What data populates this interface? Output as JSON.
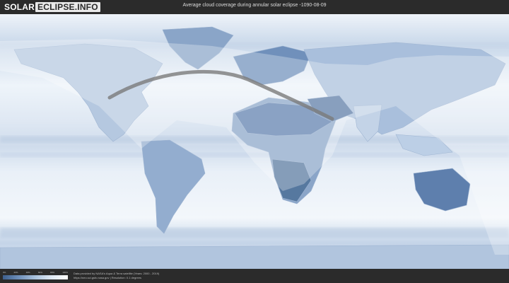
{
  "header": {
    "logo_part1": "SOLAR",
    "logo_part2": "ECLIPSE.INFO",
    "title": "Average cloud coverage during annular solar eclipse -1090-08-09"
  },
  "legend": {
    "ticks": [
      "0%",
      "20%",
      "40%",
      "60%",
      "80%",
      "100%"
    ],
    "colors": [
      "#3d5f8e",
      "#6f90ba",
      "#a9c1dc",
      "#dfe9f4",
      "#ffffff"
    ]
  },
  "footer": {
    "credit_line1": "Data provided by NASA's Aqua & Terra satellite (Years: 2000 - 2019)",
    "credit_line2": "https://neo.sci.gsfc.nasa.gov | Resolution: 0.1 degrees"
  },
  "colors": {
    "ocean_clear": "#e8eff7",
    "cloud_dense": "#ffffff",
    "land_clear": "#5f7fab",
    "eclipse_path": "#7a7a7a",
    "visibility_overlay": "#ffffff"
  }
}
